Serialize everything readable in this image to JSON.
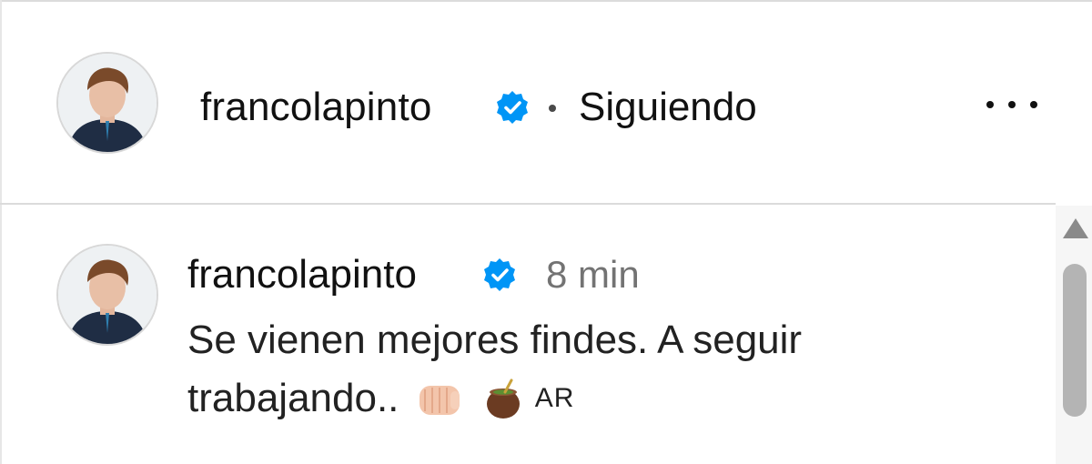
{
  "post_header": {
    "username": "francolapinto",
    "verified": true,
    "follow_status": "Siguiendo",
    "more_icon": "more-horizontal-icon"
  },
  "comment": {
    "username": "francolapinto",
    "verified": true,
    "timestamp": "8 min",
    "text_line1": "Se vienen mejores findes. A seguir",
    "text_line2": "trabajando..",
    "emojis": [
      "fist-emoji",
      "mate-emoji"
    ],
    "flag": "AR"
  },
  "colors": {
    "verified_blue": "#0095f6",
    "secondary_text": "#737373",
    "divider": "#dbdbdb",
    "scroll_thumb": "#b4b4b4"
  }
}
